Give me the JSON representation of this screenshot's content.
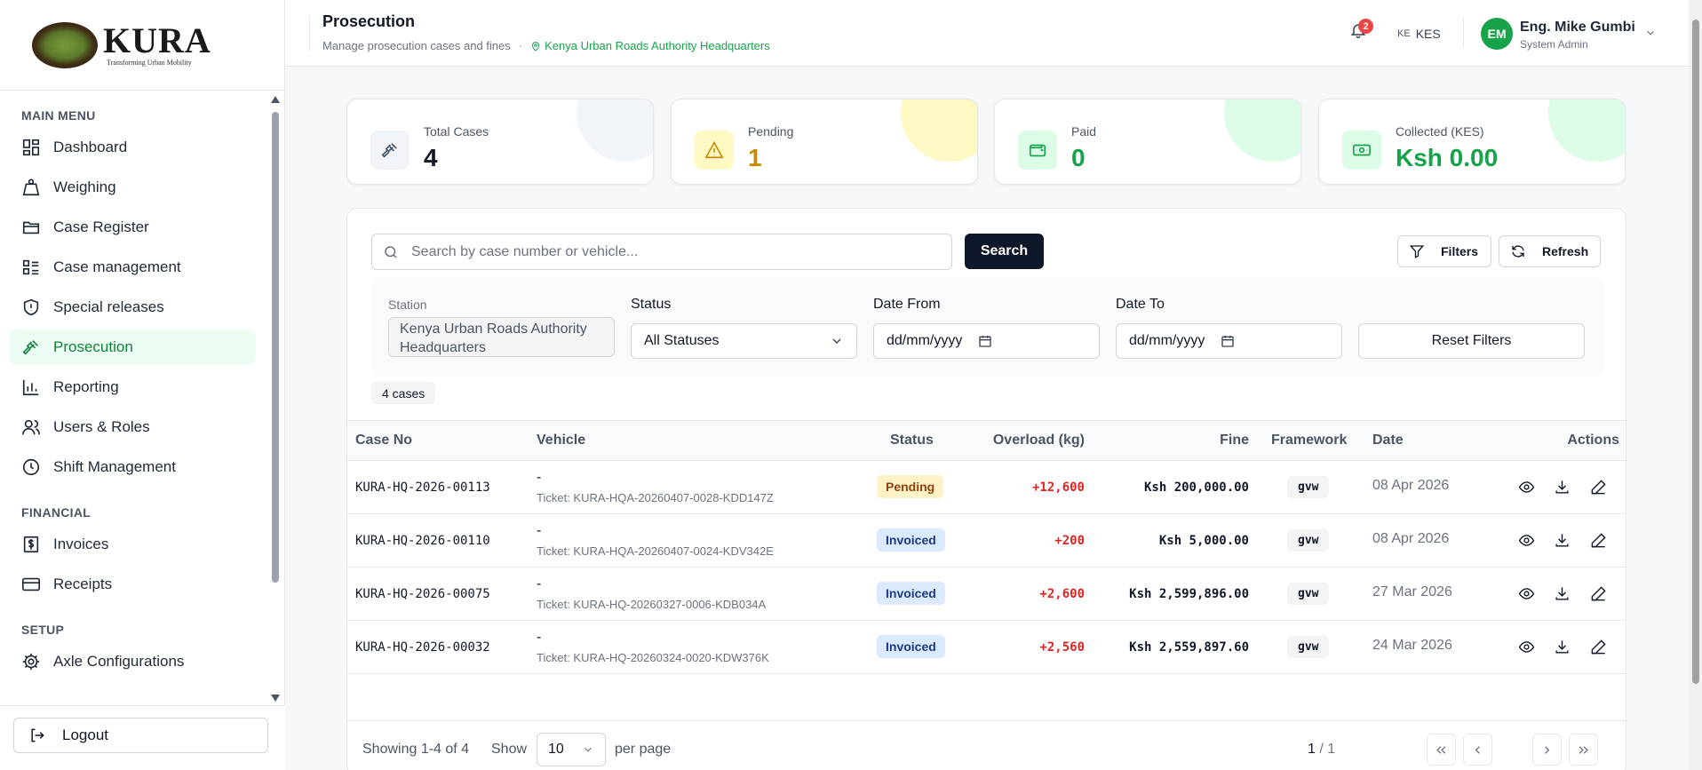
{
  "brand": {
    "name": "KURA",
    "tagline": "Transforming Urban Mobility"
  },
  "sidebar": {
    "sections": [
      {
        "title": "MAIN MENU",
        "items": [
          {
            "label": "Dashboard",
            "icon": "dashboard-icon"
          },
          {
            "label": "Weighing",
            "icon": "weight-icon"
          },
          {
            "label": "Case Register",
            "icon": "folder-icon"
          },
          {
            "label": "Case management",
            "icon": "list-icon"
          },
          {
            "label": "Special releases",
            "icon": "shield-icon"
          },
          {
            "label": "Prosecution",
            "icon": "gavel-icon",
            "active": true
          },
          {
            "label": "Reporting",
            "icon": "bar-chart-icon"
          },
          {
            "label": "Users & Roles",
            "icon": "users-icon"
          },
          {
            "label": "Shift Management",
            "icon": "clock-icon"
          }
        ]
      },
      {
        "title": "FINANCIAL",
        "items": [
          {
            "label": "Invoices",
            "icon": "dollar-doc-icon"
          },
          {
            "label": "Receipts",
            "icon": "card-icon"
          }
        ]
      },
      {
        "title": "SETUP",
        "items": [
          {
            "label": "Axle Configurations",
            "icon": "gear-icon"
          }
        ]
      }
    ],
    "logout_label": "Logout"
  },
  "header": {
    "title": "Prosecution",
    "subtitle": "Manage prosecution cases and fines",
    "station": "Kenya Urban Roads Authority Headquarters",
    "notifications": "2",
    "currency_flag": "KE",
    "currency": "KES",
    "user_initials": "EM",
    "user_name": "Eng. Mike Gumbi",
    "user_role": "System Admin"
  },
  "stats": [
    {
      "label": "Total Cases",
      "value": "4",
      "color": "#111827",
      "icon": "gavel-icon"
    },
    {
      "label": "Pending",
      "value": "1",
      "color": "#ca8a04",
      "icon": "warning-icon"
    },
    {
      "label": "Paid",
      "value": "0",
      "color": "#16a34a",
      "icon": "wallet-icon"
    },
    {
      "label": "Collected (KES)",
      "value": "Ksh 0.00",
      "color": "#16a34a",
      "icon": "cash-icon"
    }
  ],
  "search": {
    "placeholder": "Search by case number or vehicle...",
    "button": "Search"
  },
  "toolbar": {
    "filters": "Filters",
    "refresh": "Refresh"
  },
  "filters": {
    "station_label": "Station",
    "station_value": "Kenya Urban Roads Authority Headquarters",
    "status_label": "Status",
    "status_value": "All Statuses",
    "date_from_label": "Date From",
    "date_from_value": "dd/mm/yyyy",
    "date_to_label": "Date To",
    "date_to_value": "dd/mm/yyyy",
    "reset": "Reset Filters"
  },
  "case_count": "4 cases",
  "table": {
    "columns": [
      "Case No",
      "Vehicle",
      "Status",
      "Overload (kg)",
      "Fine",
      "Framework",
      "Date",
      "Actions"
    ],
    "rows": [
      {
        "case_no": "KURA-HQ-2026-00113",
        "vehicle": "-",
        "ticket": "Ticket: KURA-HQA-20260407-0028-KDD147Z",
        "status": "Pending",
        "overload": "+12,600",
        "fine": "Ksh 200,000.00",
        "framework": "gvw",
        "date": "08 Apr 2026"
      },
      {
        "case_no": "KURA-HQ-2026-00110",
        "vehicle": "-",
        "ticket": "Ticket: KURA-HQA-20260407-0024-KDV342E",
        "status": "Invoiced",
        "overload": "+200",
        "fine": "Ksh 5,000.00",
        "framework": "gvw",
        "date": "08 Apr 2026"
      },
      {
        "case_no": "KURA-HQ-2026-00075",
        "vehicle": "-",
        "ticket": "Ticket: KURA-HQ-20260327-0006-KDB034A",
        "status": "Invoiced",
        "overload": "+2,600",
        "fine": "Ksh 2,599,896.00",
        "framework": "gvw",
        "date": "27 Mar 2026"
      },
      {
        "case_no": "KURA-HQ-2026-00032",
        "vehicle": "-",
        "ticket": "Ticket: KURA-HQ-20260324-0020-KDW376K",
        "status": "Invoiced",
        "overload": "+2,560",
        "fine": "Ksh 2,559,897.60",
        "framework": "gvw",
        "date": "24 Mar 2026"
      }
    ]
  },
  "pagination": {
    "showing": "Showing 1-4 of 4",
    "show_label": "Show",
    "per_page_value": "10",
    "per_page_label": "per page",
    "current": "1",
    "total": "/ 1"
  }
}
